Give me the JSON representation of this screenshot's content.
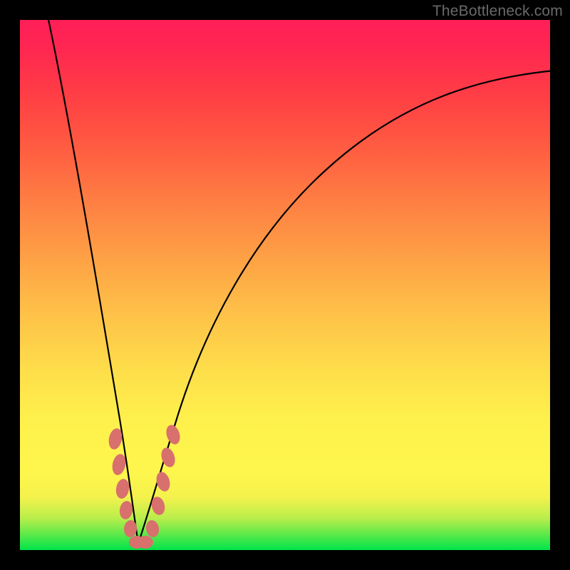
{
  "watermark": "TheBottleneck.com",
  "colors": {
    "frame": "#000000",
    "curve": "#000000",
    "marker": "#d8706d",
    "gradient_top": "#ff1f59",
    "gradient_bottom": "#00e44b"
  },
  "chart_data": {
    "type": "line",
    "title": "",
    "xlabel": "",
    "ylabel": "",
    "xlim": [
      0,
      100
    ],
    "ylim": [
      0,
      100
    ],
    "grid": false,
    "legend": false,
    "note": "V-shaped bottleneck curve; approximate values read from pixel positions on a 0–100 normalized grid (0,0 at bottom-left). Minimum (best match) near x≈22.",
    "series": [
      {
        "name": "left-branch",
        "x": [
          5,
          8,
          11,
          14,
          17,
          19,
          20.5,
          21.5,
          22
        ],
        "y": [
          100,
          80,
          60,
          40,
          22,
          11,
          5,
          1.5,
          0.5
        ]
      },
      {
        "name": "right-branch",
        "x": [
          22,
          23,
          25,
          27,
          30,
          35,
          40,
          48,
          58,
          70,
          85,
          100
        ],
        "y": [
          0.5,
          2,
          8,
          15,
          25,
          39,
          50,
          62,
          72,
          80,
          86,
          90
        ]
      }
    ],
    "markers": {
      "name": "highlighted-points",
      "note": "Salmon-colored elongated markers clustered near the trough of the V.",
      "points": [
        {
          "x": 18.0,
          "y": 20.0
        },
        {
          "x": 18.6,
          "y": 15.0
        },
        {
          "x": 19.3,
          "y": 10.5
        },
        {
          "x": 19.9,
          "y": 7.0
        },
        {
          "x": 20.6,
          "y": 3.5
        },
        {
          "x": 21.8,
          "y": 0.8
        },
        {
          "x": 23.2,
          "y": 0.8
        },
        {
          "x": 24.8,
          "y": 3.5
        },
        {
          "x": 25.8,
          "y": 8.0
        },
        {
          "x": 26.8,
          "y": 12.5
        },
        {
          "x": 27.8,
          "y": 17.0
        },
        {
          "x": 28.8,
          "y": 21.0
        }
      ]
    }
  }
}
